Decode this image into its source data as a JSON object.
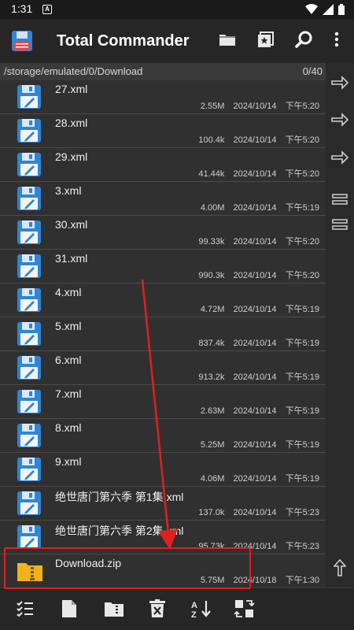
{
  "status_bar": {
    "time": "1:31",
    "notif_letter": "A"
  },
  "app": {
    "title": "Total Commander"
  },
  "path_bar": {
    "path": "/storage/emulated/0/Download",
    "count": "0/40"
  },
  "files": [
    {
      "name": "27.xml",
      "size": "2.55M",
      "date": "2024/10/14",
      "time": "下午5:20",
      "icon": "floppy-disk-icon"
    },
    {
      "name": "28.xml",
      "size": "100.4k",
      "date": "2024/10/14",
      "time": "下午5:20",
      "icon": "floppy-disk-icon"
    },
    {
      "name": "29.xml",
      "size": "41.44k",
      "date": "2024/10/14",
      "time": "下午5:20",
      "icon": "floppy-disk-icon"
    },
    {
      "name": "3.xml",
      "size": "4.00M",
      "date": "2024/10/14",
      "time": "下午5:19",
      "icon": "floppy-disk-icon"
    },
    {
      "name": "30.xml",
      "size": "99.33k",
      "date": "2024/10/14",
      "time": "下午5:20",
      "icon": "floppy-disk-icon"
    },
    {
      "name": "31.xml",
      "size": "990.3k",
      "date": "2024/10/14",
      "time": "下午5:20",
      "icon": "floppy-disk-icon"
    },
    {
      "name": "4.xml",
      "size": "4.72M",
      "date": "2024/10/14",
      "time": "下午5:19",
      "icon": "floppy-disk-icon"
    },
    {
      "name": "5.xml",
      "size": "837.4k",
      "date": "2024/10/14",
      "time": "下午5:19",
      "icon": "floppy-disk-icon"
    },
    {
      "name": "6.xml",
      "size": "913.2k",
      "date": "2024/10/14",
      "time": "下午5:19",
      "icon": "floppy-disk-icon"
    },
    {
      "name": "7.xml",
      "size": "2.63M",
      "date": "2024/10/14",
      "time": "下午5:19",
      "icon": "floppy-disk-icon"
    },
    {
      "name": "8.xml",
      "size": "5.25M",
      "date": "2024/10/14",
      "time": "下午5:19",
      "icon": "floppy-disk-icon"
    },
    {
      "name": "9.xml",
      "size": "4.06M",
      "date": "2024/10/14",
      "time": "下午5:19",
      "icon": "floppy-disk-icon"
    },
    {
      "name": "绝世唐门第六季 第1集.xml",
      "size": "137.0k",
      "date": "2024/10/14",
      "time": "下午5:23",
      "icon": "floppy-disk-icon"
    },
    {
      "name": "绝世唐门第六季 第2集.xml",
      "size": "95.73k",
      "date": "2024/10/14",
      "time": "下午5:23",
      "icon": "floppy-disk-icon"
    },
    {
      "name": "Download.zip",
      "size": "5.75M",
      "date": "2024/10/18",
      "time": "下午1:30",
      "icon": "zip-folder-icon"
    }
  ],
  "colors": {
    "accent_highlight": "#e02020",
    "disk_blue": "#2e86d6",
    "zip_yellow": "#f2b21c"
  }
}
